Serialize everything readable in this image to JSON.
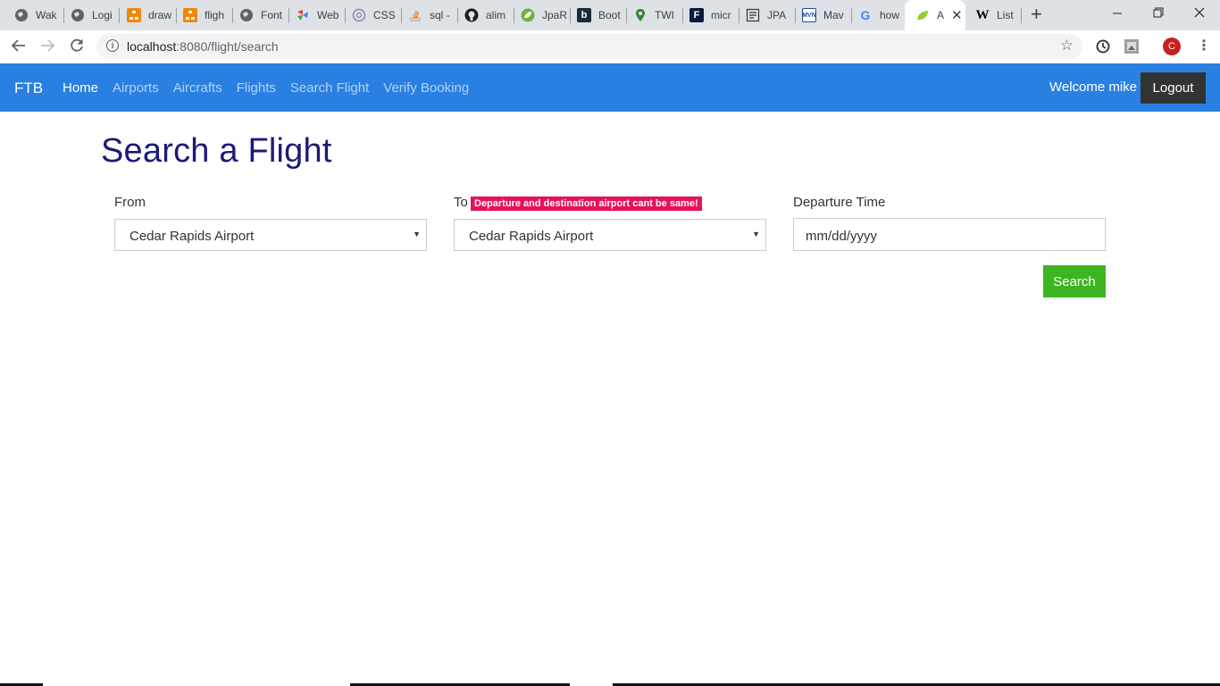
{
  "browser": {
    "tabs": [
      {
        "title": "Wak",
        "icon": "globe-icon"
      },
      {
        "title": "Logi",
        "icon": "globe-icon"
      },
      {
        "title": "draw",
        "icon": "drawio-icon"
      },
      {
        "title": "fligh",
        "icon": "drawio-icon"
      },
      {
        "title": "Font",
        "icon": "globe-icon"
      },
      {
        "title": "Web",
        "icon": "webflow-icon"
      },
      {
        "title": "CSS",
        "icon": "css-icon"
      },
      {
        "title": "sql -",
        "icon": "stackoverflow-icon"
      },
      {
        "title": "alim",
        "icon": "github-icon"
      },
      {
        "title": "JpaR",
        "icon": "spring-icon"
      },
      {
        "title": "Boot",
        "icon": "baeldung-icon"
      },
      {
        "title": "TWI",
        "icon": "map-pin-icon"
      },
      {
        "title": "micr",
        "icon": "f-icon"
      },
      {
        "title": "JPA",
        "icon": "jpa-icon"
      },
      {
        "title": "Mav",
        "icon": "maven-icon"
      },
      {
        "title": "how",
        "icon": "google-icon"
      },
      {
        "title": "A",
        "icon": "leaf-icon"
      },
      {
        "title": "List",
        "icon": "wikipedia-icon"
      }
    ],
    "new_tab_label": "+",
    "close_tab_label": "✕",
    "url_host": "localhost",
    "url_path": ":8080/flight/search",
    "profile_initial": "C"
  },
  "navbar": {
    "brand": "FTB",
    "links": [
      "Home",
      "Airports",
      "Aircrafts",
      "Flights",
      "Search Flight",
      "Verify Booking"
    ],
    "active_link": "Home",
    "welcome": "Welcome mike",
    "logout": "Logout",
    "background_color": "#2a80e1"
  },
  "page": {
    "title": "Search a Flight"
  },
  "form": {
    "from_label": "From",
    "from_value": "Cedar Rapids Airport",
    "to_label": "To",
    "to_value": "Cedar Rapids Airport",
    "error_message": "Departure and destination airport cant be same!",
    "departure_label": "Departure Time",
    "departure_placeholder": "mm/dd/yyyy",
    "search_button": "Search",
    "search_button_color": "#3cb521",
    "error_color": "#e8115b"
  }
}
